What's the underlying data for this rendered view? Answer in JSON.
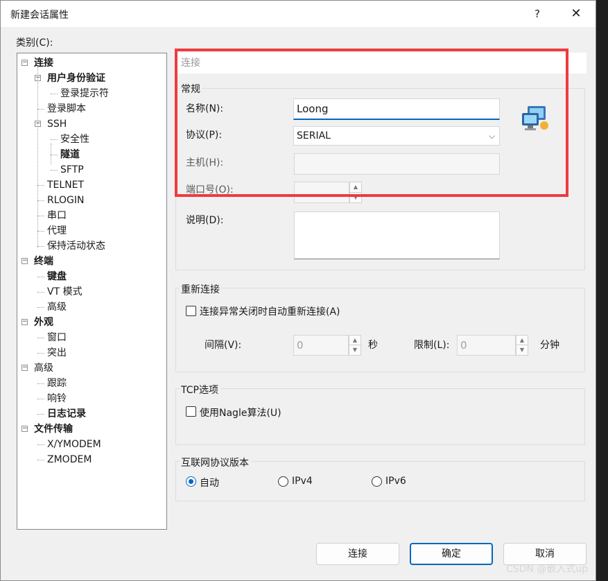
{
  "window": {
    "title": "新建会话属性",
    "help_glyph": "?",
    "close_glyph": "✕"
  },
  "category_label": "类别(C):",
  "tree": [
    {
      "label": "连接",
      "bold": true,
      "level": 0,
      "expander": "−"
    },
    {
      "label": "用户身份验证",
      "bold": true,
      "level": 1,
      "expander": "−"
    },
    {
      "label": "登录提示符",
      "bold": false,
      "level": 2
    },
    {
      "label": "登录脚本",
      "bold": false,
      "level": 1
    },
    {
      "label": "SSH",
      "bold": false,
      "level": 1,
      "expander": "−"
    },
    {
      "label": "安全性",
      "bold": false,
      "level": 2
    },
    {
      "label": "隧道",
      "bold": true,
      "level": 2
    },
    {
      "label": "SFTP",
      "bold": false,
      "level": 2
    },
    {
      "label": "TELNET",
      "bold": false,
      "level": 1
    },
    {
      "label": "RLOGIN",
      "bold": false,
      "level": 1
    },
    {
      "label": "串口",
      "bold": false,
      "level": 1
    },
    {
      "label": "代理",
      "bold": false,
      "level": 1
    },
    {
      "label": "保持活动状态",
      "bold": false,
      "level": 1
    },
    {
      "label": "终端",
      "bold": true,
      "level": 0,
      "expander": "−"
    },
    {
      "label": "键盘",
      "bold": true,
      "level": 1
    },
    {
      "label": "VT 模式",
      "bold": false,
      "level": 1
    },
    {
      "label": "高级",
      "bold": false,
      "level": 1
    },
    {
      "label": "外观",
      "bold": true,
      "level": 0,
      "expander": "−"
    },
    {
      "label": "窗口",
      "bold": false,
      "level": 1
    },
    {
      "label": "突出",
      "bold": false,
      "level": 1
    },
    {
      "label": "高级",
      "bold": false,
      "level": 0,
      "expander": "−"
    },
    {
      "label": "跟踪",
      "bold": false,
      "level": 1
    },
    {
      "label": "响铃",
      "bold": false,
      "level": 1
    },
    {
      "label": "日志记录",
      "bold": true,
      "level": 1
    },
    {
      "label": "文件传输",
      "bold": true,
      "level": 0,
      "expander": "−"
    },
    {
      "label": "X/YMODEM",
      "bold": false,
      "level": 1
    },
    {
      "label": "ZMODEM",
      "bold": false,
      "level": 1
    }
  ],
  "panel": {
    "header": "连接",
    "general": {
      "label": "常规",
      "name_label": "名称(N):",
      "name_value": "Loong",
      "protocol_label": "协议(P):",
      "protocol_value": "SERIAL",
      "host_label": "主机(H):",
      "host_value": "",
      "port_label": "端口号(O):",
      "port_value": "",
      "desc_label": "说明(D):",
      "desc_value": ""
    },
    "reconnect": {
      "label": "重新连接",
      "auto_reconnect_label": "连接异常关闭时自动重新连接(A)",
      "interval_label": "间隔(V):",
      "interval_value": "0",
      "interval_unit": "秒",
      "limit_label": "限制(L):",
      "limit_value": "0",
      "limit_unit": "分钟"
    },
    "tcp": {
      "label": "TCP选项",
      "nagle_label": "使用Nagle算法(U)"
    },
    "ip_version": {
      "label": "互联网协议版本",
      "auto": "自动",
      "ipv4": "IPv4",
      "ipv6": "IPv6",
      "selected": "auto"
    }
  },
  "buttons": {
    "connect": "连接",
    "ok": "确定",
    "cancel": "取消"
  },
  "watermark": "CSDN @嵌入式up",
  "colors": {
    "accent": "#0067c0",
    "highlight": "#ef3b3f"
  }
}
